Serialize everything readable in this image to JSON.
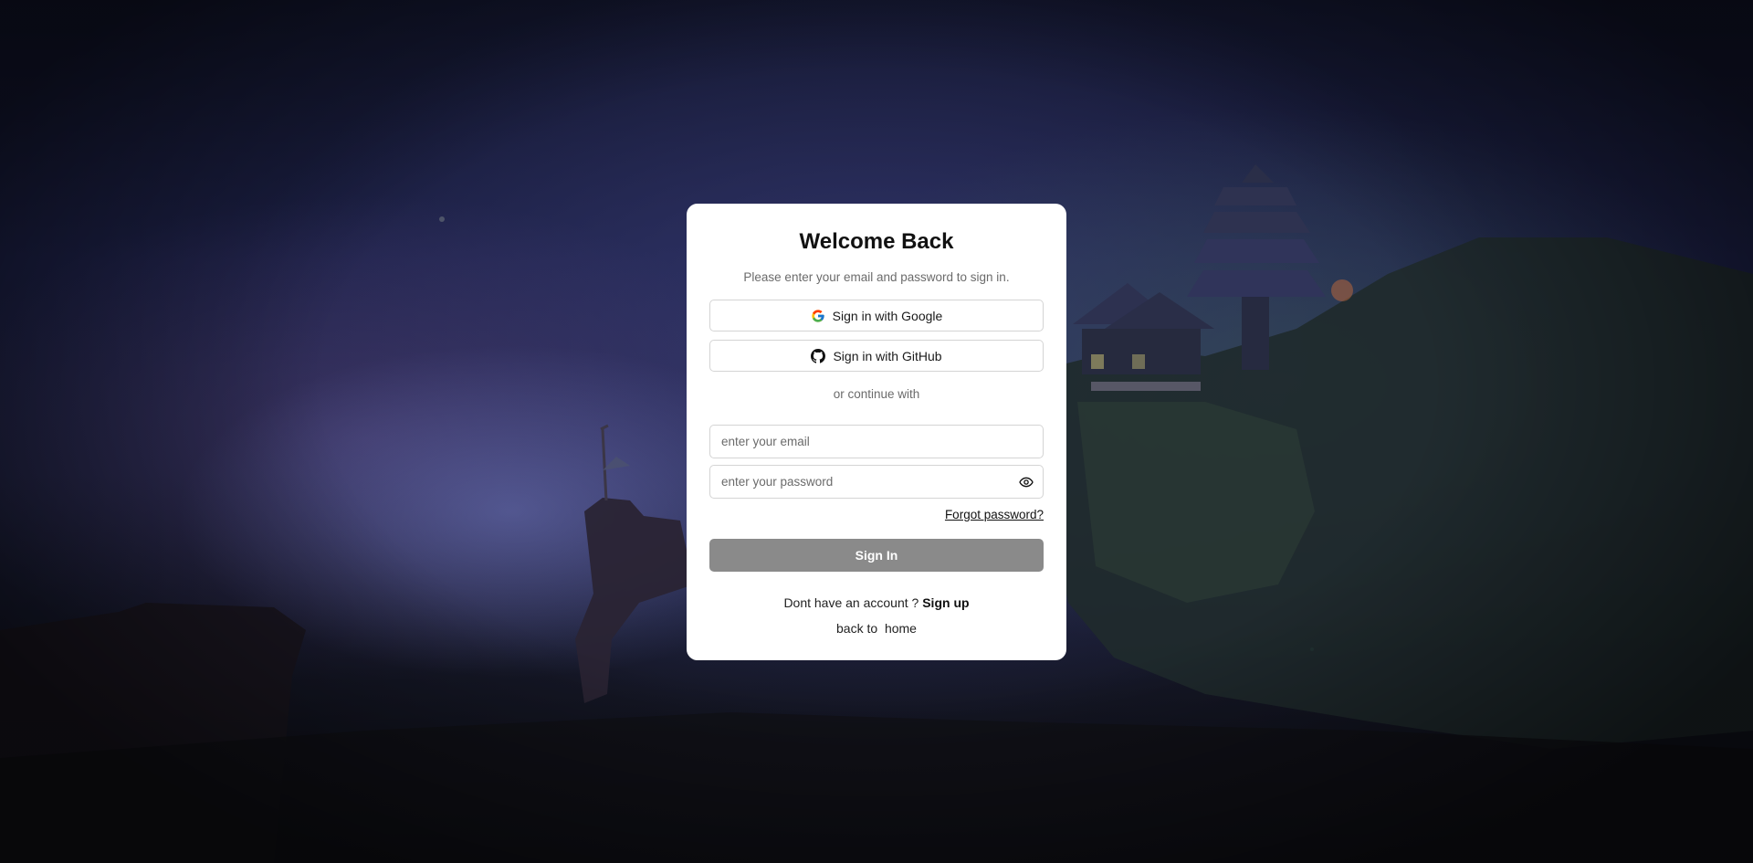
{
  "card": {
    "title": "Welcome Back",
    "subtitle": "Please enter your email and password to sign in.",
    "google_label": "Sign in with Google",
    "github_label": "Sign in with GitHub",
    "divider_text": "or continue with",
    "email": {
      "value": "",
      "placeholder": "enter your email"
    },
    "password": {
      "value": "",
      "placeholder": "enter your password"
    },
    "forgot_label": "Forgot password?",
    "signin_label": "Sign In",
    "signup_prompt": "Dont have an account ?",
    "signup_label": "Sign up",
    "back_prefix": "back to",
    "home_label": "home"
  },
  "icons": {
    "google": "google-icon",
    "github": "github-icon",
    "eye": "eye-icon"
  },
  "colors": {
    "card_bg": "#ffffff",
    "signin_button_bg": "#8a8a8a",
    "muted_text": "#6b6b6b",
    "border": "#d4d4d4"
  }
}
